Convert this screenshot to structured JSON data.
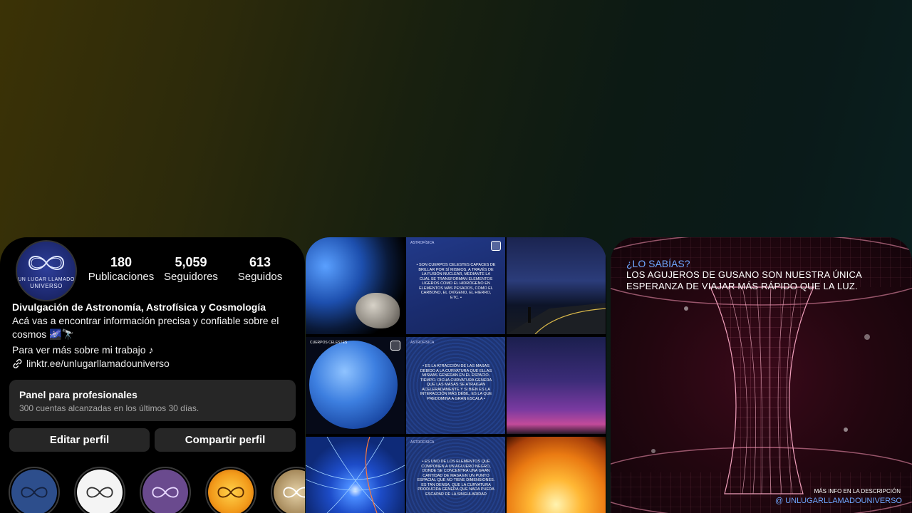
{
  "profile": {
    "stats": [
      {
        "num": "180",
        "label": "Publicaciones"
      },
      {
        "num": "5,059",
        "label": "Seguidores"
      },
      {
        "num": "613",
        "label": "Seguidos"
      }
    ],
    "avatar_text": [
      "UN LUGAR LLAMADO",
      "UNIVERSO"
    ],
    "name": "Divulgación de Astronomía, Astrofísica y Cosmología",
    "bio_line1": "Acá vas a encontrar información precisa y confiable sobre el",
    "bio_line2": "cosmos 🌌🔭",
    "bio_line3": "Para ver más sobre mi trabajo ♪",
    "link": "linktr.ee/unlugarllamadouniverso",
    "panel_title": "Panel para profesionales",
    "panel_sub": "300 cuentas alcanzadas en los últimos 30 días.",
    "edit_button": "Editar perfil",
    "share_button": "Compartir perfil"
  },
  "grid": {
    "captions": {
      "c2": "• SON CUERPOS CELESTES CAPACES DE BRILLAR POR SÍ MISMOS, A TRAVÉS DE LA FUSIÓN NUCLEAR, MEDIANTE LA CUAL SE TRANSFORMAN ELEMENTOS LIGEROS COMO EL HIDRÓGENO EN ELEMENTOS MÁS PESADOS, COMO EL CARBONO, EL OXÍGENO, EL HIERRO, ETC. •",
      "c5": "• ES LA ATRACCIÓN DE LAS MASAS DEBIDO A LA CURVATURA QUE ELLAS MISMAS GENERAN EN EL ESPACIO-TIEMPO. DICHA CURVATURA GENERA QUE LAS MASAS SE ATRAIGAN ACELERADAMENTE Y SI BIEN ES LA INTERACCIÓN MÁS DÉBIL, ES LA QUE PREDOMINA A GRAN ESCALA •",
      "c8": "• ES UNO DE LOS ELEMENTOS QUE COMPONEN A UN AGUJERO NEGRO, DONDE SE CONCENTRA UNA GRAN CANTIDAD DE MASA EN UN PUNTO ESPACIAL QUE NO TIENE DIMENSIONES. ES TAN DENSA, QUE LA CURVATURA PRODUCIDA GENERA QUE NADA PUEDA ESCAPAR DE LA SINGULARIDAD"
    },
    "headers": {
      "c2": "ASTROFÍSICA",
      "c5": "ASTROFÍSICA",
      "c8": "ASTROFÍSICA",
      "c4": "CUERPOS CELESTES"
    }
  },
  "reel": {
    "question": "¿LO SABÍAS?",
    "text_line1": "LOS AGUJEROS DE GUSANO SON NUESTRA ÚNICA",
    "text_line2": "ESPERANZA DE VIAJAR MÁS RÁPIDO QUE LA LUZ.",
    "more_info": "MÁS INFO EN LA DESCRIPCIÓN",
    "handle": "@ UNLUGARLLAMADOUNIVERSO"
  }
}
